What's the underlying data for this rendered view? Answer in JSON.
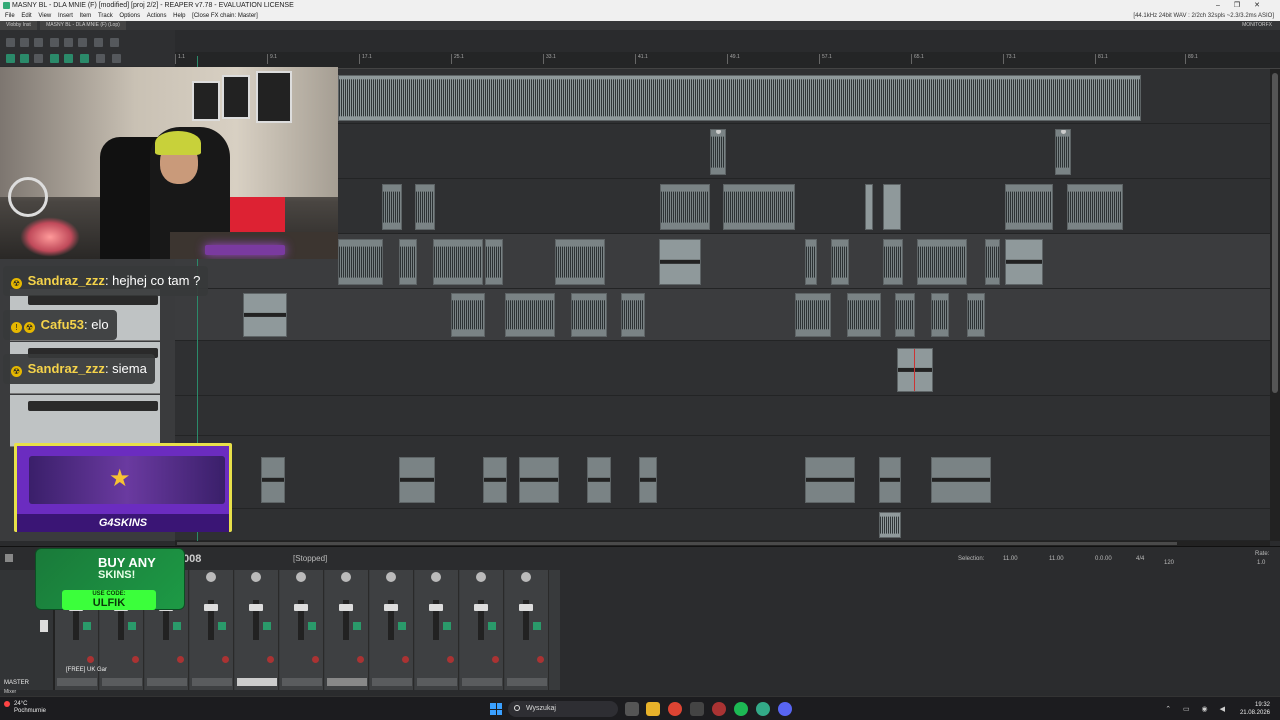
{
  "window": {
    "title": "MASNY BL - DLA MNIE (F) [modified] [proj 2/2] - REAPER v7.78 - EVALUATION LICENSE",
    "controls": [
      "–",
      "❐",
      "✕"
    ]
  },
  "menu": {
    "items": [
      "File",
      "Edit",
      "View",
      "Insert",
      "Item",
      "Track",
      "Options",
      "Actions",
      "Help",
      "[Close FX chain: Master]"
    ],
    "status": "[44.1kHz 24bit WAV : 2/2ch 32spls ~2.3/3.2ms ASIO]"
  },
  "tabs": {
    "items": [
      "Vlobby Inst",
      "MASNY BL - DLA MNIE (F) (Lop)"
    ],
    "monitor": "MONITORFX"
  },
  "ruler": {
    "ticks": [
      "1.1",
      "9.1",
      "17.1",
      "25.1",
      "33.1",
      "41.1",
      "49.1",
      "57.1",
      "65.1",
      "73.1",
      "81.1",
      "89.1"
    ]
  },
  "chat": [
    {
      "user": "Sandraz_zzz",
      "message": "hejhej co tam ?"
    },
    {
      "user": "Cafu53",
      "message": "elo"
    },
    {
      "user": "Sandraz_zzz",
      "message": "siema"
    }
  ],
  "promo": {
    "brand": "G4SKINS",
    "buy_line1": "BUY ANY",
    "buy_line2": "SKINS!",
    "code_label": "USE CODE:",
    "code": "ULFIK"
  },
  "transport": {
    "time": "008",
    "state": "[Stopped]",
    "selection_label": "Selection:",
    "sel_start": "11.00",
    "sel_end": "11.00",
    "sel_len": "0.0.00",
    "time_sig": "4/4",
    "bpm": "120",
    "rate_label": "Rate:",
    "rate": "1.0"
  },
  "mixer": {
    "master_label": "MASTER",
    "track_name": "[FREE] UK Gar",
    "mixer_tab": "Mixer"
  },
  "taskbar": {
    "temp": "24°C",
    "weather": "Pochmurnie",
    "search": "Wyszukaj",
    "time": "19:32",
    "date": "21.08.2026"
  },
  "colors": {
    "accent": "#2b8a6a",
    "chat_user": "#f5d34a",
    "promo_purple": "#6b2cc0",
    "code_green": "#3bff3b"
  }
}
